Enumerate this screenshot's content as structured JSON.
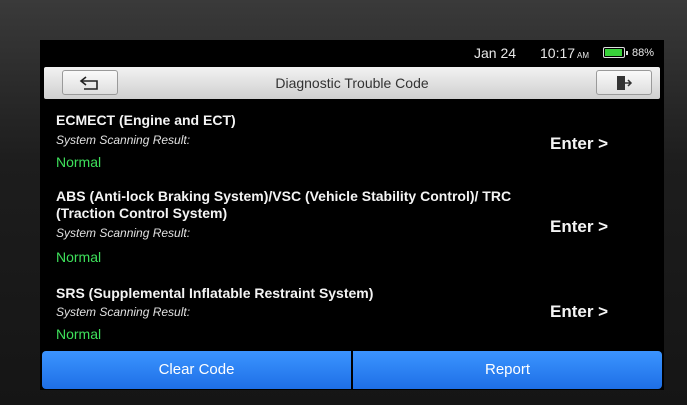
{
  "status": {
    "date": "Jan 24",
    "time": "10:17",
    "ampm": "AM",
    "battery": "88%",
    "battery_color": "#39d23a"
  },
  "header": {
    "title": "Diagnostic Trouble Code",
    "back_icon": "back-arrow-icon",
    "exit_icon": "exit-door-icon"
  },
  "systems": [
    {
      "name": "ECMECT (Engine and ECT)",
      "sub": "System Scanning Result:",
      "result": "Normal",
      "action": "Enter >"
    },
    {
      "name": "ABS (Anti-lock Braking System)/VSC (Vehicle Stability Control)/ TRC (Traction Control System)",
      "sub": "System Scanning Result:",
      "result": "Normal",
      "action": "Enter >"
    },
    {
      "name": "SRS (Supplemental Inflatable Restraint System)",
      "sub": "System Scanning Result:",
      "result": "Normal",
      "action": "Enter >"
    }
  ],
  "footer": {
    "clear_label": "Clear Code",
    "report_label": "Report",
    "accent": "#2a82f6"
  },
  "colors": {
    "normal": "#3ee05b",
    "background": "#000000"
  }
}
